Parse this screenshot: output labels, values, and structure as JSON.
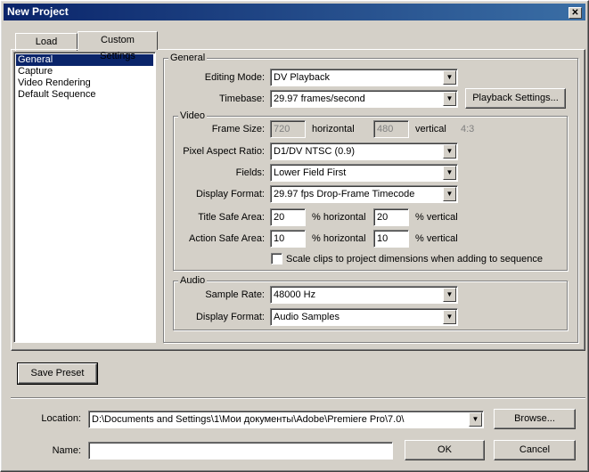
{
  "window": {
    "title": "New Project",
    "close_glyph": "✕"
  },
  "tabs": [
    {
      "label": "Load Preset"
    },
    {
      "label": "Custom Settings"
    }
  ],
  "sidebar": {
    "items": [
      {
        "label": "General",
        "selected": true
      },
      {
        "label": "Capture"
      },
      {
        "label": "Video Rendering"
      },
      {
        "label": "Default Sequence"
      }
    ]
  },
  "general": {
    "group_title": "General",
    "editing_mode": {
      "label": "Editing Mode:",
      "value": "DV Playback"
    },
    "timebase": {
      "label": "Timebase:",
      "value": "29.97 frames/second"
    },
    "playback_settings_button": "Playback Settings..."
  },
  "video": {
    "group_title": "Video",
    "frame_size": {
      "label": "Frame Size:",
      "horizontal_value": "720",
      "horizontal_label": "horizontal",
      "vertical_value": "480",
      "vertical_label": "vertical",
      "aspect": "4:3"
    },
    "pixel_aspect": {
      "label": "Pixel Aspect Ratio:",
      "value": "D1/DV NTSC (0.9)"
    },
    "fields": {
      "label": "Fields:",
      "value": "Lower Field First"
    },
    "display_format": {
      "label": "Display Format:",
      "value": "29.97 fps Drop-Frame Timecode"
    },
    "title_safe": {
      "label": "Title Safe Area:",
      "horizontal_value": "20",
      "horizontal_label": "% horizontal",
      "vertical_value": "20",
      "vertical_label": "% vertical"
    },
    "action_safe": {
      "label": "Action Safe Area:",
      "horizontal_value": "10",
      "horizontal_label": "% horizontal",
      "vertical_value": "10",
      "vertical_label": "% vertical"
    },
    "scale_clips": {
      "label": "Scale clips to project dimensions when adding to sequence",
      "checked": false
    }
  },
  "audio": {
    "group_title": "Audio",
    "sample_rate": {
      "label": "Sample Rate:",
      "value": "48000 Hz"
    },
    "display_format": {
      "label": "Display Format:",
      "value": "Audio Samples"
    }
  },
  "buttons": {
    "save_preset": "Save Preset",
    "browse": "Browse...",
    "ok": "OK",
    "cancel": "Cancel"
  },
  "footer": {
    "location_label": "Location:",
    "location_value": "D:\\Documents and Settings\\1\\Мои документы\\Adobe\\Premiere Pro\\7.0\\",
    "name_label": "Name:",
    "name_value": ""
  },
  "icons": {
    "dropdown": "▼"
  }
}
